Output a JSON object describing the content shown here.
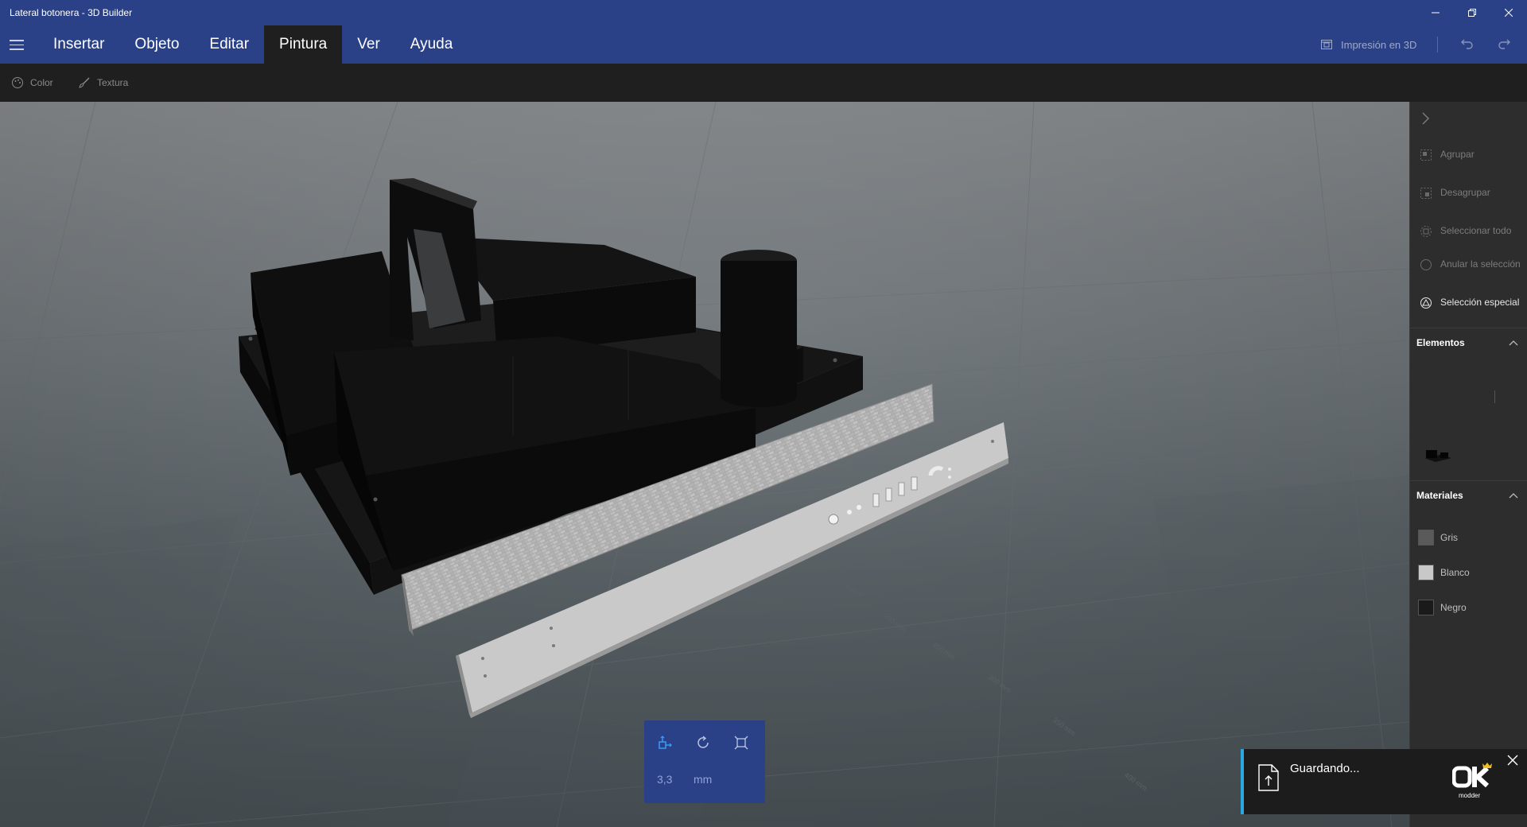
{
  "window": {
    "title": "Lateral botonera - 3D Builder"
  },
  "menu": {
    "items": [
      {
        "label": "Insertar"
      },
      {
        "label": "Objeto"
      },
      {
        "label": "Editar"
      },
      {
        "label": "Pintura",
        "active": true
      },
      {
        "label": "Ver"
      },
      {
        "label": "Ayuda"
      }
    ],
    "print_label": "Impresión en 3D"
  },
  "ribbon": {
    "color_label": "Color",
    "texture_label": "Textura"
  },
  "scene": {
    "ruler_labels": [
      "150 mm",
      "200 mm",
      "250 mm",
      "300 mm",
      "350 mm",
      "400 mm"
    ]
  },
  "panel": {
    "actions": [
      {
        "label": "Agrupar",
        "enabled": false
      },
      {
        "label": "Desagrupar",
        "enabled": false
      },
      {
        "label": "Seleccionar todo",
        "enabled": false
      },
      {
        "label": "Anular la selección",
        "enabled": false
      },
      {
        "label": "Selección especial",
        "enabled": true
      }
    ],
    "elements_title": "Elementos",
    "materials_title": "Materiales",
    "materials": [
      {
        "label": "Gris",
        "color": "#5a5a5a"
      },
      {
        "label": "Blanco",
        "color": "#c8c8c8"
      },
      {
        "label": "Negro",
        "color": "#1a1a1a"
      }
    ]
  },
  "transform_widget": {
    "value": "3,3",
    "unit": "mm"
  },
  "toast": {
    "message": "Guardando...",
    "logo_text": "modder"
  },
  "colors": {
    "brand": "#2b4187",
    "toast_accent": "#2aa8e0"
  }
}
